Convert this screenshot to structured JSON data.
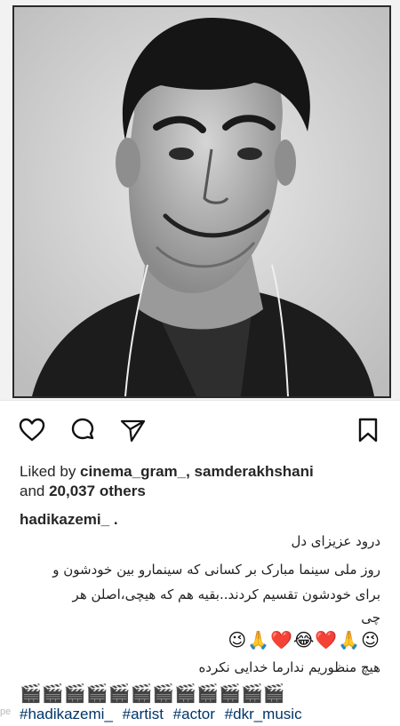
{
  "post": {
    "image_alt": "Black and white portrait photo",
    "likes": {
      "prefix": "Liked by ",
      "users": "cinema_gram_, samderakhshani",
      "line2_and": "and ",
      "others": "20,037 others"
    },
    "author": "hadikazemi_ .",
    "caption": {
      "line1": "درود عزیزای دل",
      "line2": "روز ملی سینما مبارک بر کسانی که سینمارو بین خودشون و",
      "line3": "برای خودشون تقسیم کردند..بقیه هم که هیچی،اصلن هر",
      "line4": "چی",
      "emojis": "😉🙏❤️😂❤️🙏😉",
      "line5": "هیچ منظوریم ندارما خدایی نکرده",
      "claps": "🎬🎬🎬🎬🎬🎬🎬🎬🎬🎬🎬🎬"
    },
    "hashtags": [
      "#hadikazemi_",
      "#artist",
      "#actor",
      "#dkr_music"
    ]
  },
  "icons": {
    "like": "heart-icon",
    "comment": "comment-icon",
    "share": "send-icon",
    "save": "bookmark-icon"
  },
  "watermark": "pe"
}
